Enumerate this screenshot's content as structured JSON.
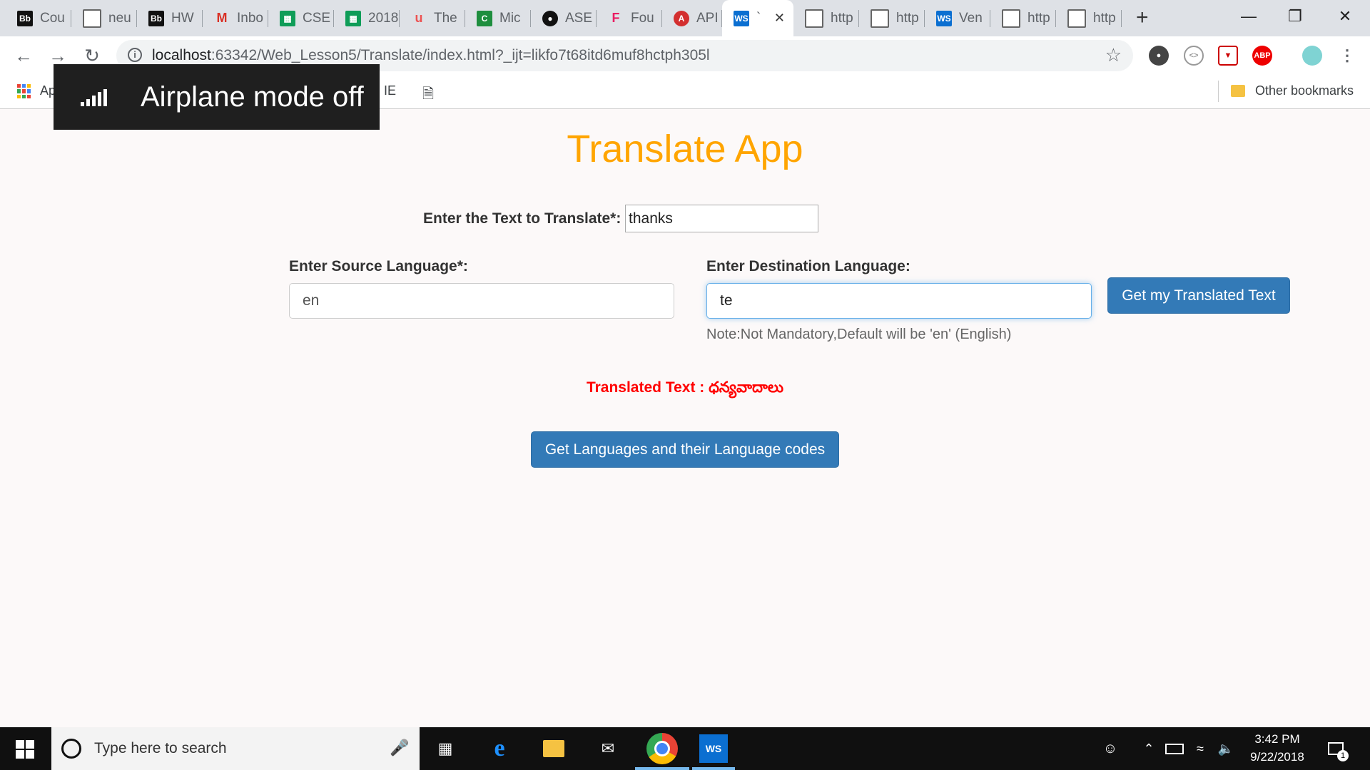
{
  "browser": {
    "tabs": [
      {
        "title": "Cou",
        "icon": "blackboard-icon"
      },
      {
        "title": "neu",
        "icon": "page-icon"
      },
      {
        "title": "HW",
        "icon": "blackboard-icon"
      },
      {
        "title": "Inbo",
        "icon": "gmail-icon"
      },
      {
        "title": "CSE",
        "icon": "sheets-icon"
      },
      {
        "title": "2018",
        "icon": "sheets-icon"
      },
      {
        "title": "The",
        "icon": "udemy-icon"
      },
      {
        "title": "Mic",
        "icon": "app-icon"
      },
      {
        "title": "ASE",
        "icon": "github-icon"
      },
      {
        "title": "Fou",
        "icon": "flag-icon"
      },
      {
        "title": "API",
        "icon": "api-icon"
      },
      {
        "title": "`",
        "icon": "webstorm-icon",
        "active": true
      },
      {
        "title": "http",
        "icon": "page-icon"
      },
      {
        "title": "http",
        "icon": "page-icon"
      },
      {
        "title": "Ven",
        "icon": "webstorm-icon"
      },
      {
        "title": "http",
        "icon": "page-icon"
      },
      {
        "title": "http",
        "icon": "page-icon"
      }
    ],
    "url_host": "localhost",
    "url_rest": ":63342/Web_Lesson5/Translate/index.html?_ijt=likfo7t68itd6muf8hctph305l",
    "bookmarks": {
      "apps": "Apps",
      "from_ie": "rom IE",
      "other": "Other bookmarks"
    }
  },
  "overlay": {
    "text": "Airplane mode off"
  },
  "app": {
    "title": "Translate App",
    "text_label": "Enter the Text to Translate*:",
    "text_value": "thanks",
    "source_label": "Enter Source Language*:",
    "source_value": "en",
    "dest_label": "Enter Destination Language:",
    "dest_value": "te",
    "translate_button": "Get my Translated Text",
    "note": "Note:Not Mandatory,Default will be 'en' (English)",
    "result": "Translated Text : ధన్యవాదాలు",
    "languages_button": "Get Languages and their Language codes"
  },
  "taskbar": {
    "search_placeholder": "Type here to search",
    "time": "3:42 PM",
    "date": "9/22/2018",
    "notification_count": "1"
  },
  "colors": {
    "title": "#ffa500",
    "primary": "#337ab7",
    "result": "#ff0000"
  }
}
